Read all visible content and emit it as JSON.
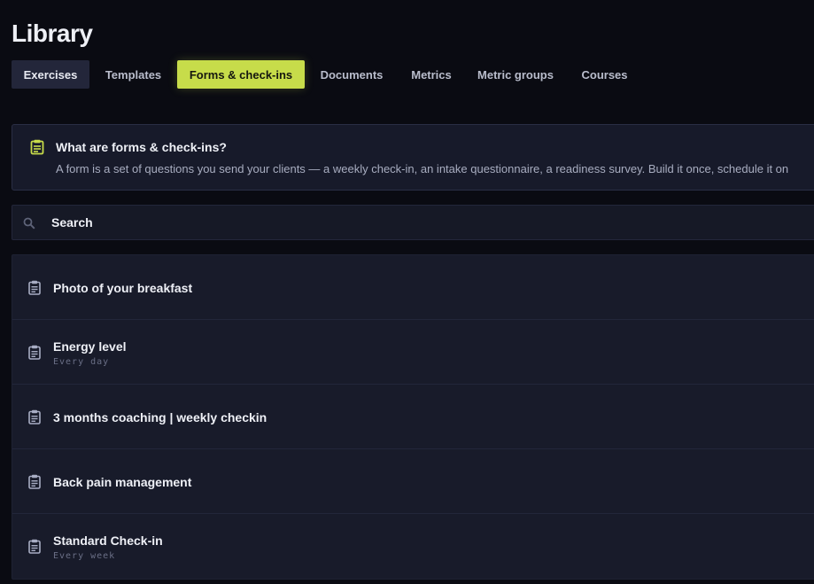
{
  "page": {
    "title": "Library"
  },
  "tabs": [
    {
      "label": "Exercises",
      "state": "selected"
    },
    {
      "label": "Templates",
      "state": "default"
    },
    {
      "label": "Forms & check-ins",
      "state": "highlighted"
    },
    {
      "label": "Documents",
      "state": "default"
    },
    {
      "label": "Metrics",
      "state": "default"
    },
    {
      "label": "Metric groups",
      "state": "default"
    },
    {
      "label": "Courses",
      "state": "default"
    }
  ],
  "info": {
    "icon": "clipboard-icon",
    "heading": "What are forms & check-ins?",
    "body": "A form is a set of questions you send your clients — a weekly check-in, an intake questionnaire, a readiness survey. Build it once, schedule it on"
  },
  "search": {
    "icon": "search-icon",
    "placeholder": "Search"
  },
  "forms": [
    {
      "name": "Photo of your breakfast",
      "schedule": ""
    },
    {
      "name": "Energy level",
      "schedule": "Every day"
    },
    {
      "name": "3 months coaching | weekly checkin",
      "schedule": ""
    },
    {
      "name": "Back pain management",
      "schedule": ""
    },
    {
      "name": "Standard Check-in",
      "schedule": "Every week"
    }
  ],
  "colors": {
    "background": "#0a0b12",
    "accent": "#c7dc4a",
    "panel": "#171a2a",
    "text": "#eef0f6",
    "muted": "#6a6f86"
  }
}
